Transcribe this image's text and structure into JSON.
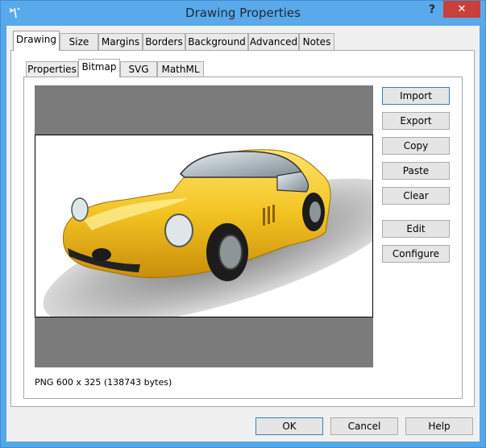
{
  "window": {
    "title": "Drawing Properties",
    "help_label": "?",
    "close_label": "✕"
  },
  "tabs": [
    {
      "label": "Drawing",
      "active": true
    },
    {
      "label": "Size"
    },
    {
      "label": "Margins"
    },
    {
      "label": "Borders"
    },
    {
      "label": "Background"
    },
    {
      "label": "Advanced"
    },
    {
      "label": "Notes"
    }
  ],
  "subtabs": [
    {
      "label": "Properties"
    },
    {
      "label": "Bitmap",
      "active": true
    },
    {
      "label": "SVG"
    },
    {
      "label": "MathML"
    }
  ],
  "actions": {
    "import": "Import",
    "export": "Export",
    "copy": "Copy",
    "paste": "Paste",
    "clear": "Clear",
    "edit": "Edit",
    "configure": "Configure"
  },
  "image_info": "PNG 600 x 325 (138743 bytes)",
  "footer": {
    "ok": "OK",
    "cancel": "Cancel",
    "help": "Help"
  },
  "colors": {
    "titlebar": "#5aa9ea",
    "close": "#c7403a",
    "preview_bg": "#7b7b7b",
    "car": "#f2c322"
  }
}
